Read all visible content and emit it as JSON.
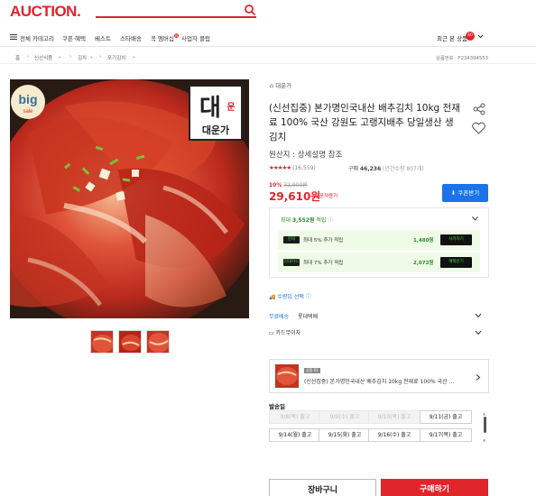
{
  "header": {
    "logo": "AUCTION.",
    "search_icon": "search-icon"
  },
  "nav": {
    "all_categories": "전체 카테고리",
    "items": [
      "쿠폰·혜택",
      "베스트",
      "스타배송",
      "꼭 멤버십",
      "사업자 클럽"
    ],
    "membership_badge": "N",
    "login": "최근 본 상품",
    "recent_count": "40"
  },
  "breadcrumb": {
    "home": "홈",
    "items": [
      "신선식품",
      "김치",
      "포기김치"
    ],
    "product_no": "상품번호 : F234394553"
  },
  "image": {
    "badge_big": "big",
    "badge_sale": "sale",
    "stamp_top": "대",
    "stamp_mid": "운",
    "stamp_side": "대운가",
    "brand": "대운가"
  },
  "product": {
    "store": "대운가",
    "title": "(신선집중) 본가명인국내산 배추김치 10kg 전재료 100% 국산 강원도 고랭지배추 당일생산 생김치",
    "origin": "원산지 : 상세설명 참조",
    "stars": "★★★★★",
    "review_count": "(16,559)",
    "purchase_label": "구매",
    "purchase_count": "46,236",
    "purchase_sub": "(년간수량 807개)",
    "discount": "10%",
    "original_price": "32,900원",
    "price": "29,610원",
    "price_sub": "쿠폰적용가",
    "coupon_button": "쿠폰받기"
  },
  "points": {
    "title_prefix": "최대",
    "title_amount": "3,552원",
    "title_suffix": "적립",
    "cards": [
      {
        "logo": "현대",
        "text": "최대 5% 추가 적립",
        "amount": "1,480원",
        "button": "사카하기"
      },
      {
        "logo": "현대카드",
        "text": "최대 7% 추가 적립",
        "amount": "2,072원",
        "button": "혜택받기"
      }
    ]
  },
  "options": {
    "qty_label": "수량입 선택",
    "delivery_label": "무료배송",
    "delivery_carrier": "롯데택배",
    "no_interest": "카드무이자"
  },
  "selected": {
    "badge": "상품 01",
    "text": "(신선집중) 본가명인국내산 배추김치 10kg 전재료 100% 국산 ..."
  },
  "shipping": {
    "label": "발송일",
    "dates": [
      {
        "text": "9/8(목) 출고",
        "disabled": true
      },
      {
        "text": "9/9(수) 출고",
        "disabled": true
      },
      {
        "text": "9/10(목) 출고",
        "disabled": true
      },
      {
        "text": "9/11(금) 출고",
        "disabled": false
      },
      {
        "text": "9/14(월) 출고",
        "disabled": false
      },
      {
        "text": "9/15(화) 출고",
        "disabled": false
      },
      {
        "text": "9/16(수) 출고",
        "disabled": false
      },
      {
        "text": "9/17(목) 출고",
        "disabled": false
      }
    ]
  },
  "actions": {
    "cart": "장바구니",
    "buy": "구매하기"
  },
  "colors": {
    "brand": "#e0252a",
    "accent_blue": "#1a73e8",
    "points_green": "#2a8a2a"
  }
}
